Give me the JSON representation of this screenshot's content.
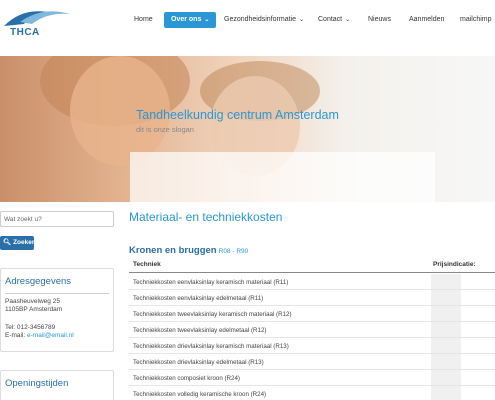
{
  "brand": {
    "logo_text": "THCA"
  },
  "nav": {
    "items": [
      {
        "label": "Home",
        "caret": ""
      },
      {
        "label": "Over ons",
        "caret": "⌄"
      },
      {
        "label": "Gezondheidsinformatie",
        "caret": "⌄"
      },
      {
        "label": "Contact",
        "caret": "⌄"
      },
      {
        "label": "Nieuws",
        "caret": ""
      },
      {
        "label": "Aanmelden",
        "caret": ""
      },
      {
        "label": "mailchimp",
        "caret": ""
      }
    ],
    "active_index": 1
  },
  "hero": {
    "title": "Tandheelkundig centrum Amsterdam",
    "slogan": "dit is onze slogan"
  },
  "sidebar": {
    "search": {
      "placeholder": "Wat zoekt u?",
      "button_label": "Zoeken"
    },
    "address": {
      "title": "Adresgegevens",
      "street": "Paasheuvelweg 25",
      "city": "1105BP Amsterdam",
      "tel": "Tel: 012-3456789",
      "email_label": "E-mail: ",
      "email": "e-mail@email.nl"
    },
    "hours": {
      "title": "Openingstijden"
    }
  },
  "main": {
    "title": "Materiaal- en techniekkosten",
    "section": {
      "title": "Kronen en bruggen",
      "code": "R08 - R90"
    },
    "table": {
      "headers": {
        "technique": "Techniek",
        "price": "Prijsindicatie:"
      },
      "rows": [
        "Techniekkosten eenvlaksinlay keramisch materiaal (R11)",
        "Techniekkosten eenvlaksinlay edelmetaal (R11)",
        "Techniekkosten tweevlaksinlay keramisch materiaal (R12)",
        "Techniekkosten tweevlaksinlay edelmetaal (R12)",
        "Techniekkosten drievlaksinlay keramisch materiaal (R13)",
        "Techniekkosten drievlaksinlay edelmetaal (R13)",
        "Techniekkosten composiet kroon (R24)",
        "Techniekkosten volledig keramische kroon (R24)"
      ]
    }
  },
  "colors": {
    "accent": "#2a97d4",
    "dark_blue": "#2a6fa8"
  }
}
